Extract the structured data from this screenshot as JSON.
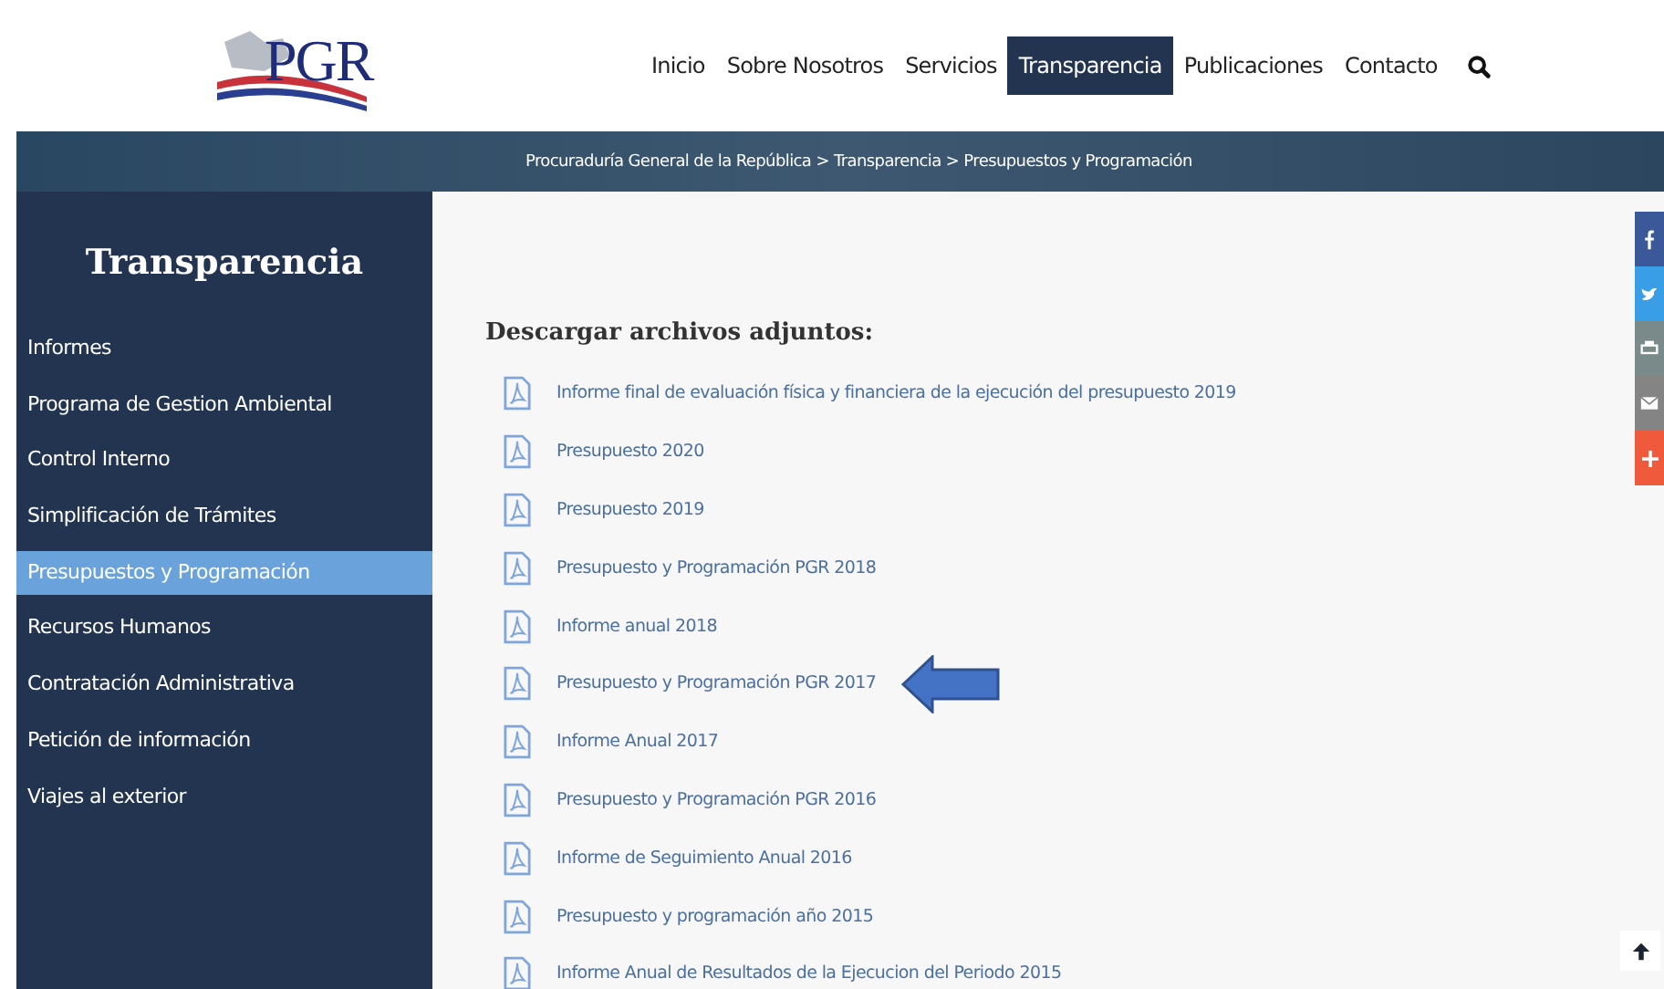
{
  "header": {
    "logo": "PGR",
    "nav": [
      {
        "label": "Inicio",
        "selected": false
      },
      {
        "label": "Sobre Nosotros",
        "selected": false
      },
      {
        "label": "Servicios",
        "selected": false
      },
      {
        "label": "Transparencia",
        "selected": true
      },
      {
        "label": "Publicaciones",
        "selected": false
      },
      {
        "label": "Contacto",
        "selected": false
      }
    ]
  },
  "breadcrumb": "Procuraduría General de la República > Transparencia > Presupuestos y Programación",
  "sidebar": {
    "title": "Transparencia",
    "items": [
      {
        "label": "Informes",
        "selected": false
      },
      {
        "label": "Programa de Gestion Ambiental",
        "selected": false
      },
      {
        "label": "Control Interno",
        "selected": false
      },
      {
        "label": "Simplificación de Trámites",
        "selected": false
      },
      {
        "label": "Presupuestos y Programación",
        "selected": true
      },
      {
        "label": "Recursos Humanos",
        "selected": false
      },
      {
        "label": "Contratación Administrativa",
        "selected": false
      },
      {
        "label": "Petición de información",
        "selected": false
      },
      {
        "label": "Viajes al exterior",
        "selected": false
      }
    ]
  },
  "content": {
    "heading": "Descargar archivos adjuntos:",
    "files": [
      {
        "label": "Informe final de evaluación física y financiera de la ejecución del presupuesto 2019",
        "highlighted": false
      },
      {
        "label": "Presupuesto 2020",
        "highlighted": false
      },
      {
        "label": "Presupuesto 2019",
        "highlighted": false
      },
      {
        "label": "Presupuesto y Programación PGR 2018",
        "highlighted": false
      },
      {
        "label": "Informe anual 2018",
        "highlighted": false
      },
      {
        "label": "Presupuesto y Programación PGR 2017",
        "highlighted": true
      },
      {
        "label": "Informe Anual 2017",
        "highlighted": false
      },
      {
        "label": "Presupuesto y Programación PGR 2016",
        "highlighted": false
      },
      {
        "label": "Informe de Seguimiento Anual 2016",
        "highlighted": false
      },
      {
        "label": "Presupuesto y programación año 2015",
        "highlighted": false
      },
      {
        "label": "Informe Anual de Resultados de la Ejecucion del Periodo 2015",
        "highlighted": false
      }
    ]
  },
  "share": [
    {
      "kind": "facebook",
      "color": "#3b5998"
    },
    {
      "kind": "twitter",
      "color": "#3a9ee6"
    },
    {
      "kind": "print",
      "color": "#7a8a8a"
    },
    {
      "kind": "mail",
      "color": "#848484"
    },
    {
      "kind": "plus",
      "color": "#ef5a3c"
    }
  ]
}
